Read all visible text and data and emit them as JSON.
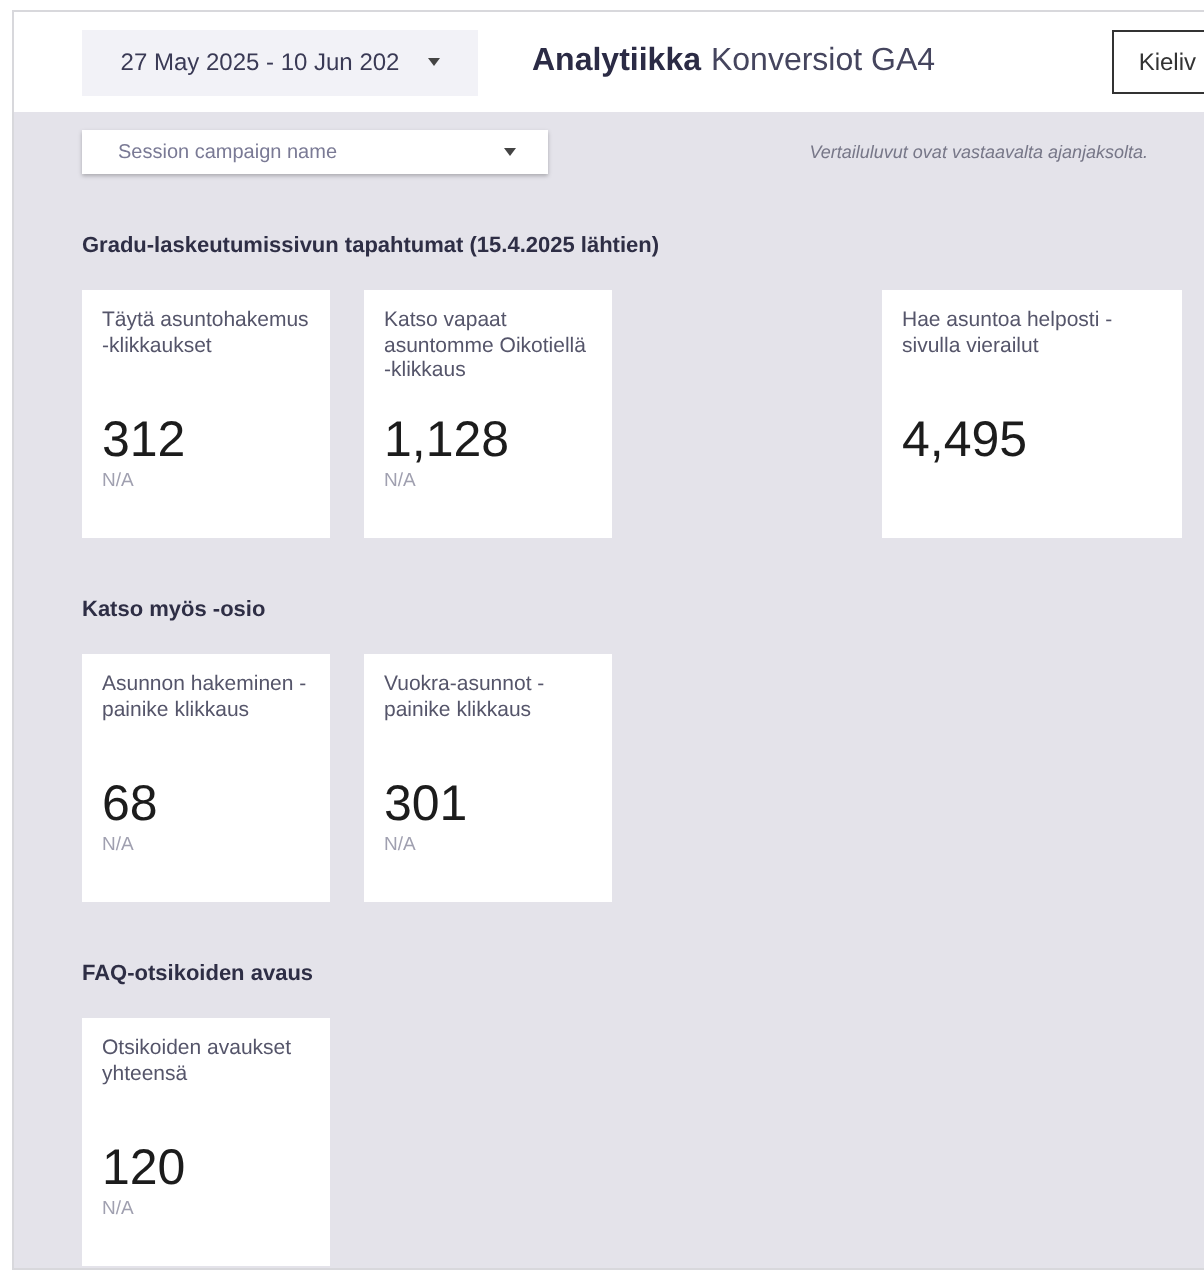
{
  "header": {
    "date_range": "27 May 2025 - 10 Jun 202",
    "title_bold": "Analytiikka",
    "title_rest": "Konversiot GA4",
    "language_button": "Kieliv"
  },
  "filter": {
    "placeholder": "Session campaign name"
  },
  "note": "Vertailuluvut ovat vastaavalta ajanjaksolta.",
  "sections": [
    {
      "heading": "Gradu-laskeutumissivun tapahtumat (15.4.2025 lähtien)",
      "cards": [
        {
          "label": "Täytä asuntohakemus -klikkaukset",
          "value": "312",
          "comparison": "N/A"
        },
        {
          "label": "Katso vapaat asuntomme Oikotiellä -klikkaus",
          "value": "1,128",
          "comparison": "N/A"
        },
        {
          "label": "Hae asuntoa helposti -sivulla vierailut",
          "value": "4,495"
        }
      ]
    },
    {
      "heading": "Katso myös -osio",
      "cards": [
        {
          "label": "Asunnon hakeminen -painike klikkaus",
          "value": "68",
          "comparison": "N/A"
        },
        {
          "label": "Vuokra-asunnot -painike klikkaus",
          "value": "301",
          "comparison": "N/A"
        }
      ]
    },
    {
      "heading": "FAQ-otsikoiden avaus",
      "cards": [
        {
          "label": "Otsikoiden avaukset yhteensä",
          "value": "120",
          "comparison": "N/A"
        }
      ]
    }
  ]
}
